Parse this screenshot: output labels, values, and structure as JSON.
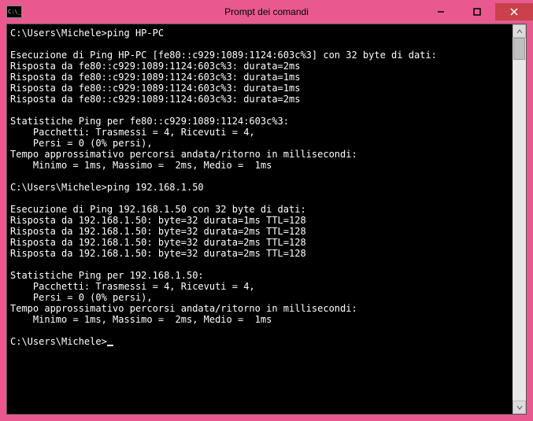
{
  "window": {
    "title": "Prompt dei comandi"
  },
  "terminal": {
    "prompt1_prefix": "C:\\Users\\Michele>",
    "prompt1_cmd": "ping HP-PC",
    "block1_l1": "Esecuzione di Ping HP-PC [fe80::c929:1089:1124:603c%3] con 32 byte di dati:",
    "block1_l2": "Risposta da fe80::c929:1089:1124:603c%3: durata=2ms",
    "block1_l3": "Risposta da fe80::c929:1089:1124:603c%3: durata=1ms",
    "block1_l4": "Risposta da fe80::c929:1089:1124:603c%3: durata=1ms",
    "block1_l5": "Risposta da fe80::c929:1089:1124:603c%3: durata=2ms",
    "stats1_l1": "Statistiche Ping per fe80::c929:1089:1124:603c%3:",
    "stats1_l2": "    Pacchetti: Trasmessi = 4, Ricevuti = 4,",
    "stats1_l3": "    Persi = 0 (0% persi),",
    "stats1_l4": "Tempo approssimativo percorsi andata/ritorno in millisecondi:",
    "stats1_l5": "    Minimo = 1ms, Massimo =  2ms, Medio =  1ms",
    "prompt2_prefix": "C:\\Users\\Michele>",
    "prompt2_cmd": "ping 192.168.1.50",
    "block2_l1": "Esecuzione di Ping 192.168.1.50 con 32 byte di dati:",
    "block2_l2": "Risposta da 192.168.1.50: byte=32 durata=1ms TTL=128",
    "block2_l3": "Risposta da 192.168.1.50: byte=32 durata=2ms TTL=128",
    "block2_l4": "Risposta da 192.168.1.50: byte=32 durata=2ms TTL=128",
    "block2_l5": "Risposta da 192.168.1.50: byte=32 durata=2ms TTL=128",
    "stats2_l1": "Statistiche Ping per 192.168.1.50:",
    "stats2_l2": "    Pacchetti: Trasmessi = 4, Ricevuti = 4,",
    "stats2_l3": "    Persi = 0 (0% persi),",
    "stats2_l4": "Tempo approssimativo percorsi andata/ritorno in millisecondi:",
    "stats2_l5": "    Minimo = 1ms, Massimo =  2ms, Medio =  1ms",
    "prompt3_prefix": "C:\\Users\\Michele>"
  }
}
